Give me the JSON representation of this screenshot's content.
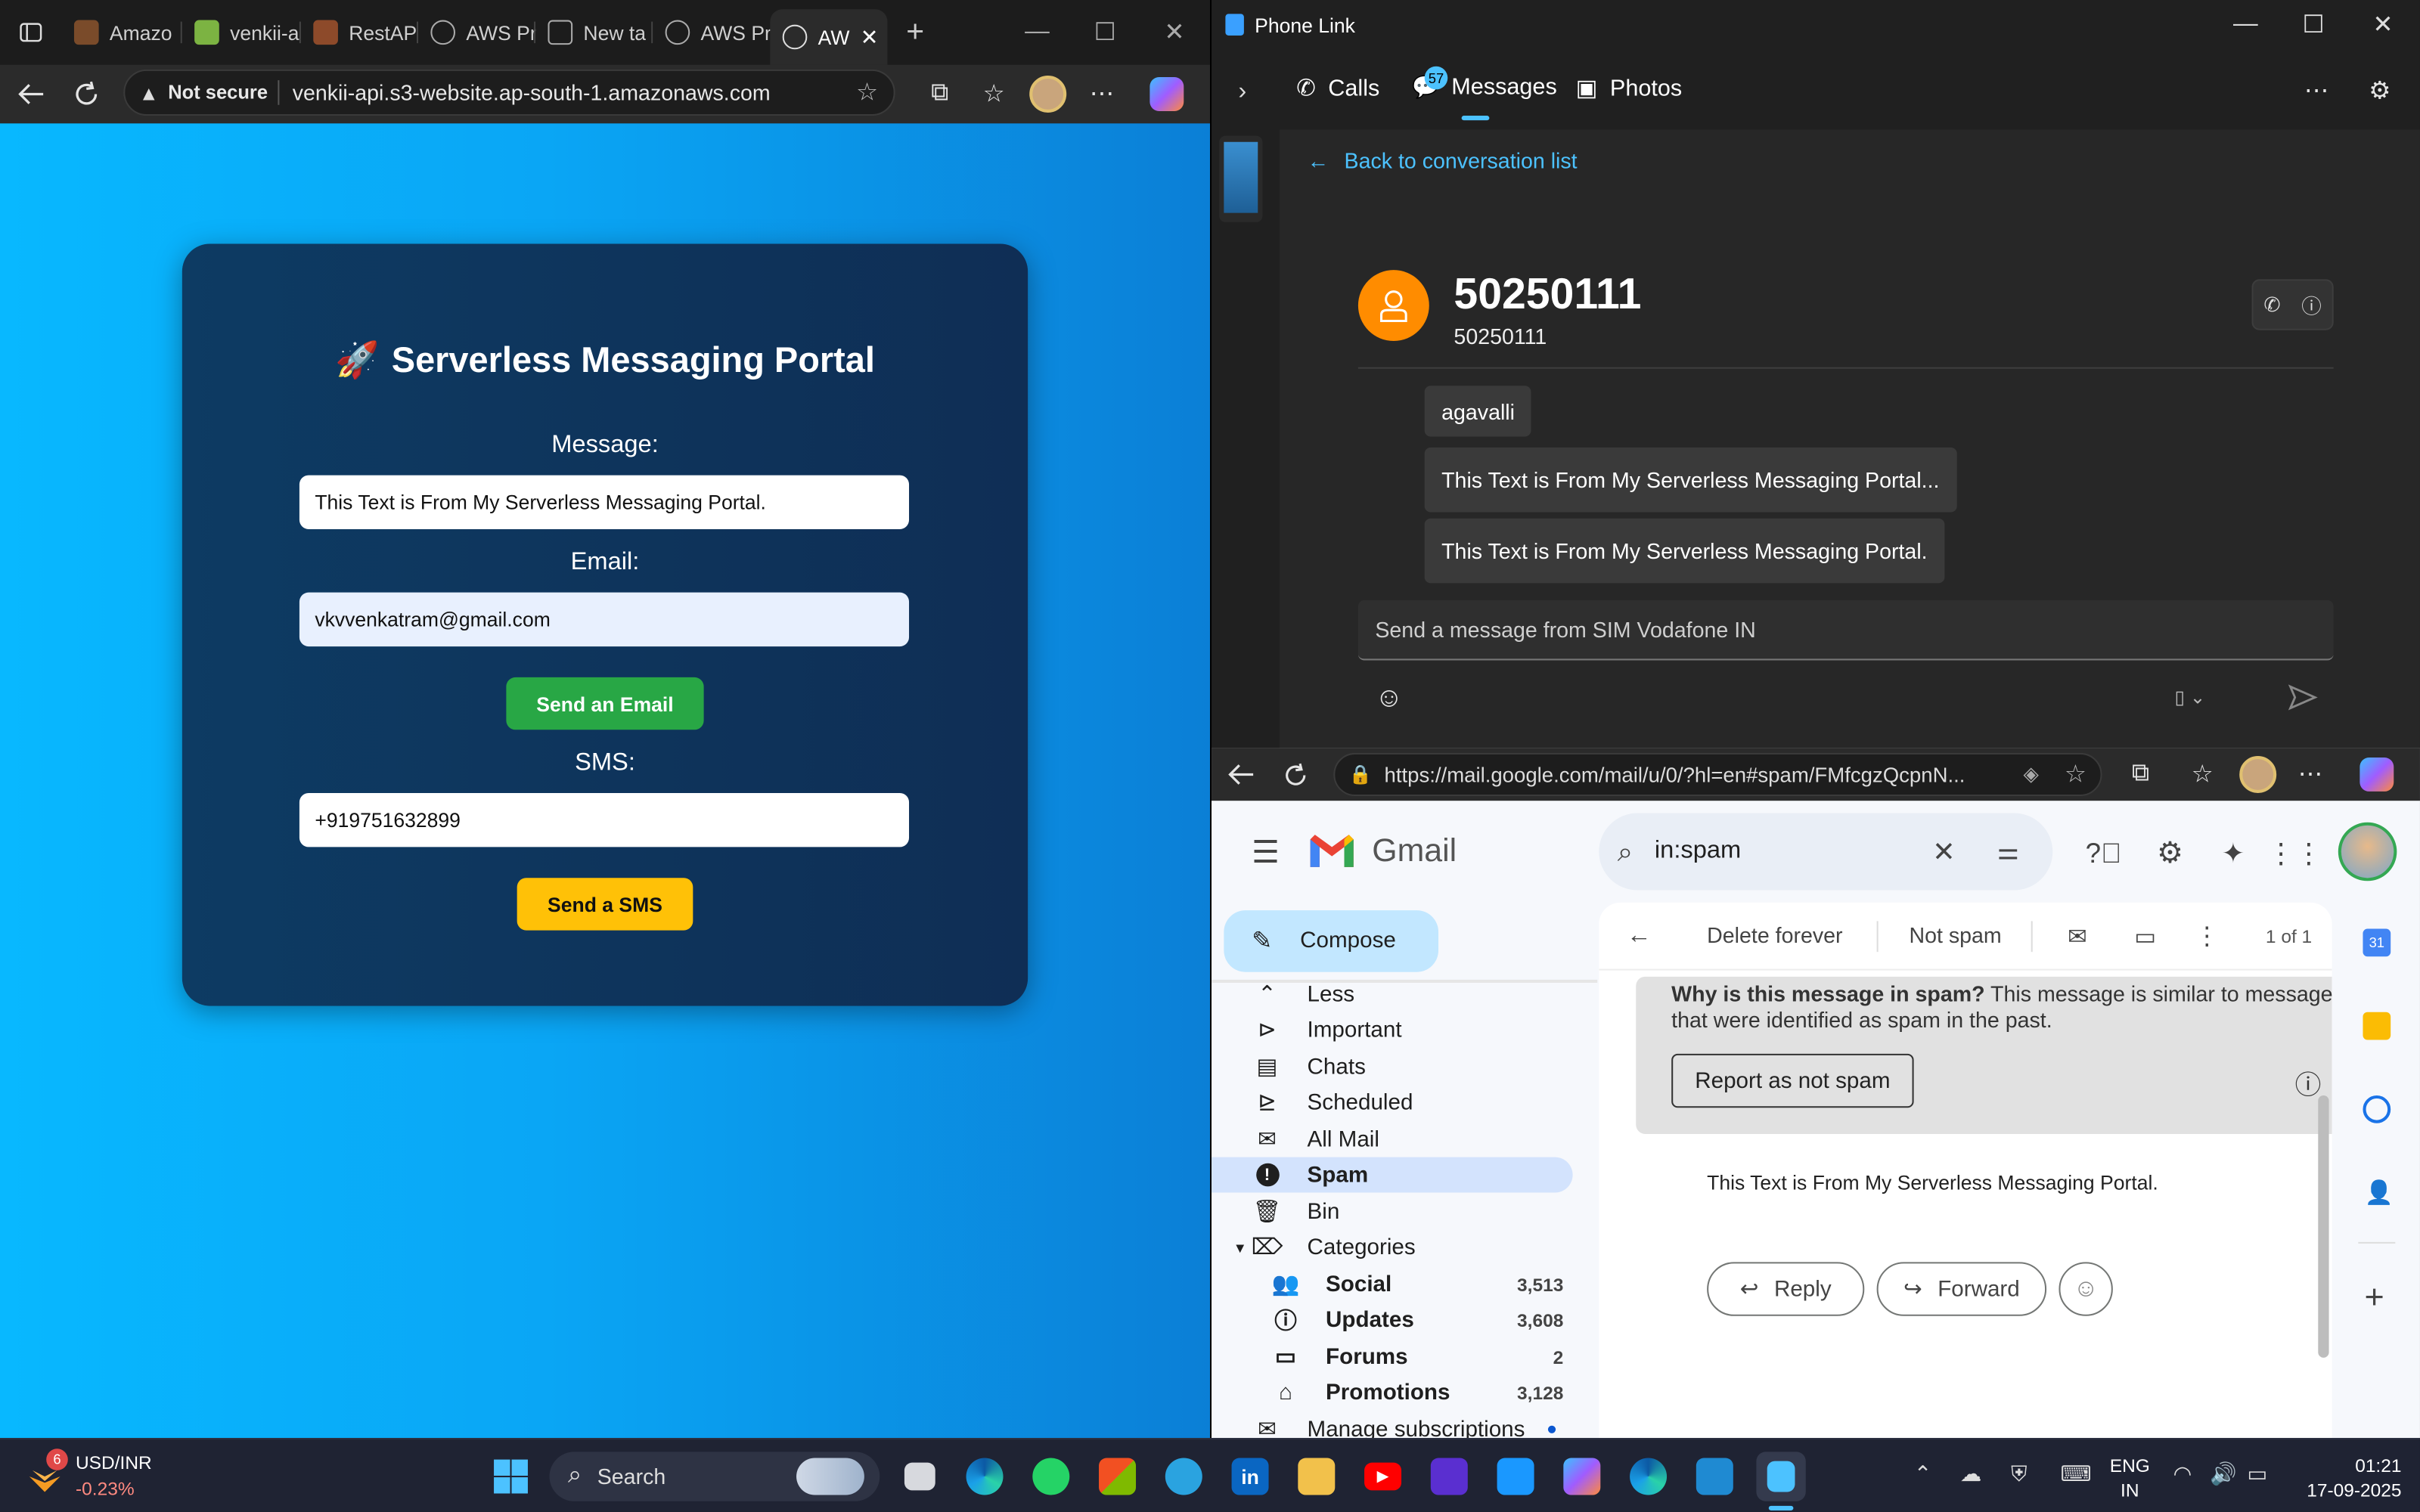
{
  "browser_left": {
    "tabs": [
      {
        "label": "Amazo",
        "favicon_color": "#7a4b2a"
      },
      {
        "label": "venkii-a",
        "favicon_color": "#7cb342"
      },
      {
        "label": "RestAPI",
        "favicon_color": "#8d4a2a"
      },
      {
        "label": "AWS Pr",
        "favicon_color": "#9aa0a6"
      },
      {
        "label": "New ta",
        "favicon_color": "#9aa0a6"
      },
      {
        "label": "AWS Pr",
        "favicon_color": "#9aa0a6"
      },
      {
        "label": "AW",
        "favicon_color": "#9aa0a6"
      }
    ],
    "address": {
      "security_label": "Not secure",
      "url": "venkii-api.s3-website.ap-south-1.amazonaws.com"
    }
  },
  "portal": {
    "title": "Serverless Messaging Portal",
    "title_emoji": "🚀",
    "message_label": "Message:",
    "message_value": "This Text is From My Serverless Messaging Portal.",
    "email_label": "Email:",
    "email_value": "vkvvenkatram@gmail.com",
    "send_email_button": "Send an Email",
    "sms_label": "SMS:",
    "sms_value": "+919751632899",
    "send_sms_button": "Send a SMS",
    "colors": {
      "email_button": "#28a745",
      "sms_button": "#ffc107"
    }
  },
  "phone_link": {
    "window_title": "Phone Link",
    "nav": {
      "calls": "Calls",
      "messages": "Messages",
      "messages_badge": "57",
      "photos": "Photos"
    },
    "back_label": "Back to conversation list",
    "contact_name": "50250111",
    "contact_number": "50250111",
    "messages": [
      "agavalli",
      "This Text is From My Serverless Messaging Portal...",
      "This Text is From My Serverless Messaging Portal."
    ],
    "compose_placeholder": "Send a message from SIM Vodafone IN"
  },
  "gmail": {
    "url": "https://mail.google.com/mail/u/0/?hl=en#spam/FMfcgzQcpnN...",
    "brand": "Gmail",
    "search_value": "in:spam",
    "compose": "Compose",
    "toolbar": {
      "delete_forever": "Delete forever",
      "not_spam": "Not spam",
      "pager": "1 of 1"
    },
    "sidebar": [
      {
        "label": "Less",
        "icon": "chevron-up-icon"
      },
      {
        "label": "Important",
        "icon": "important-icon"
      },
      {
        "label": "Chats",
        "icon": "chat-icon"
      },
      {
        "label": "Scheduled",
        "icon": "scheduled-icon"
      },
      {
        "label": "All Mail",
        "icon": "all-mail-icon"
      },
      {
        "label": "Spam",
        "icon": "spam-icon"
      },
      {
        "label": "Bin",
        "icon": "trash-icon"
      },
      {
        "label": "Categories",
        "icon": "label-icon"
      }
    ],
    "categories": [
      {
        "label": "Social",
        "count": "3,513",
        "icon": "people-icon"
      },
      {
        "label": "Updates",
        "count": "3,608",
        "icon": "info-icon"
      },
      {
        "label": "Forums",
        "count": "2",
        "icon": "forum-icon"
      },
      {
        "label": "Promotions",
        "count": "3,128",
        "icon": "tag-icon"
      }
    ],
    "manage_subscriptions": "Manage subscriptions",
    "spam_banner": {
      "heading": "Why is this message in spam?",
      "text_part1": "This message is similar to messages",
      "text_part2": "that were identified as spam in the past.",
      "button": "Report as not spam"
    },
    "email_body": "This Text is From My Serverless Messaging Portal.",
    "reply": "Reply",
    "forward": "Forward"
  },
  "taskbar": {
    "widget_badge": "6",
    "ticker": "USD/INR",
    "ticker_change": "-0.23%",
    "search_placeholder": "Search",
    "lang_top": "ENG",
    "lang_bottom": "IN",
    "time": "01:21",
    "date": "17-09-2025"
  }
}
